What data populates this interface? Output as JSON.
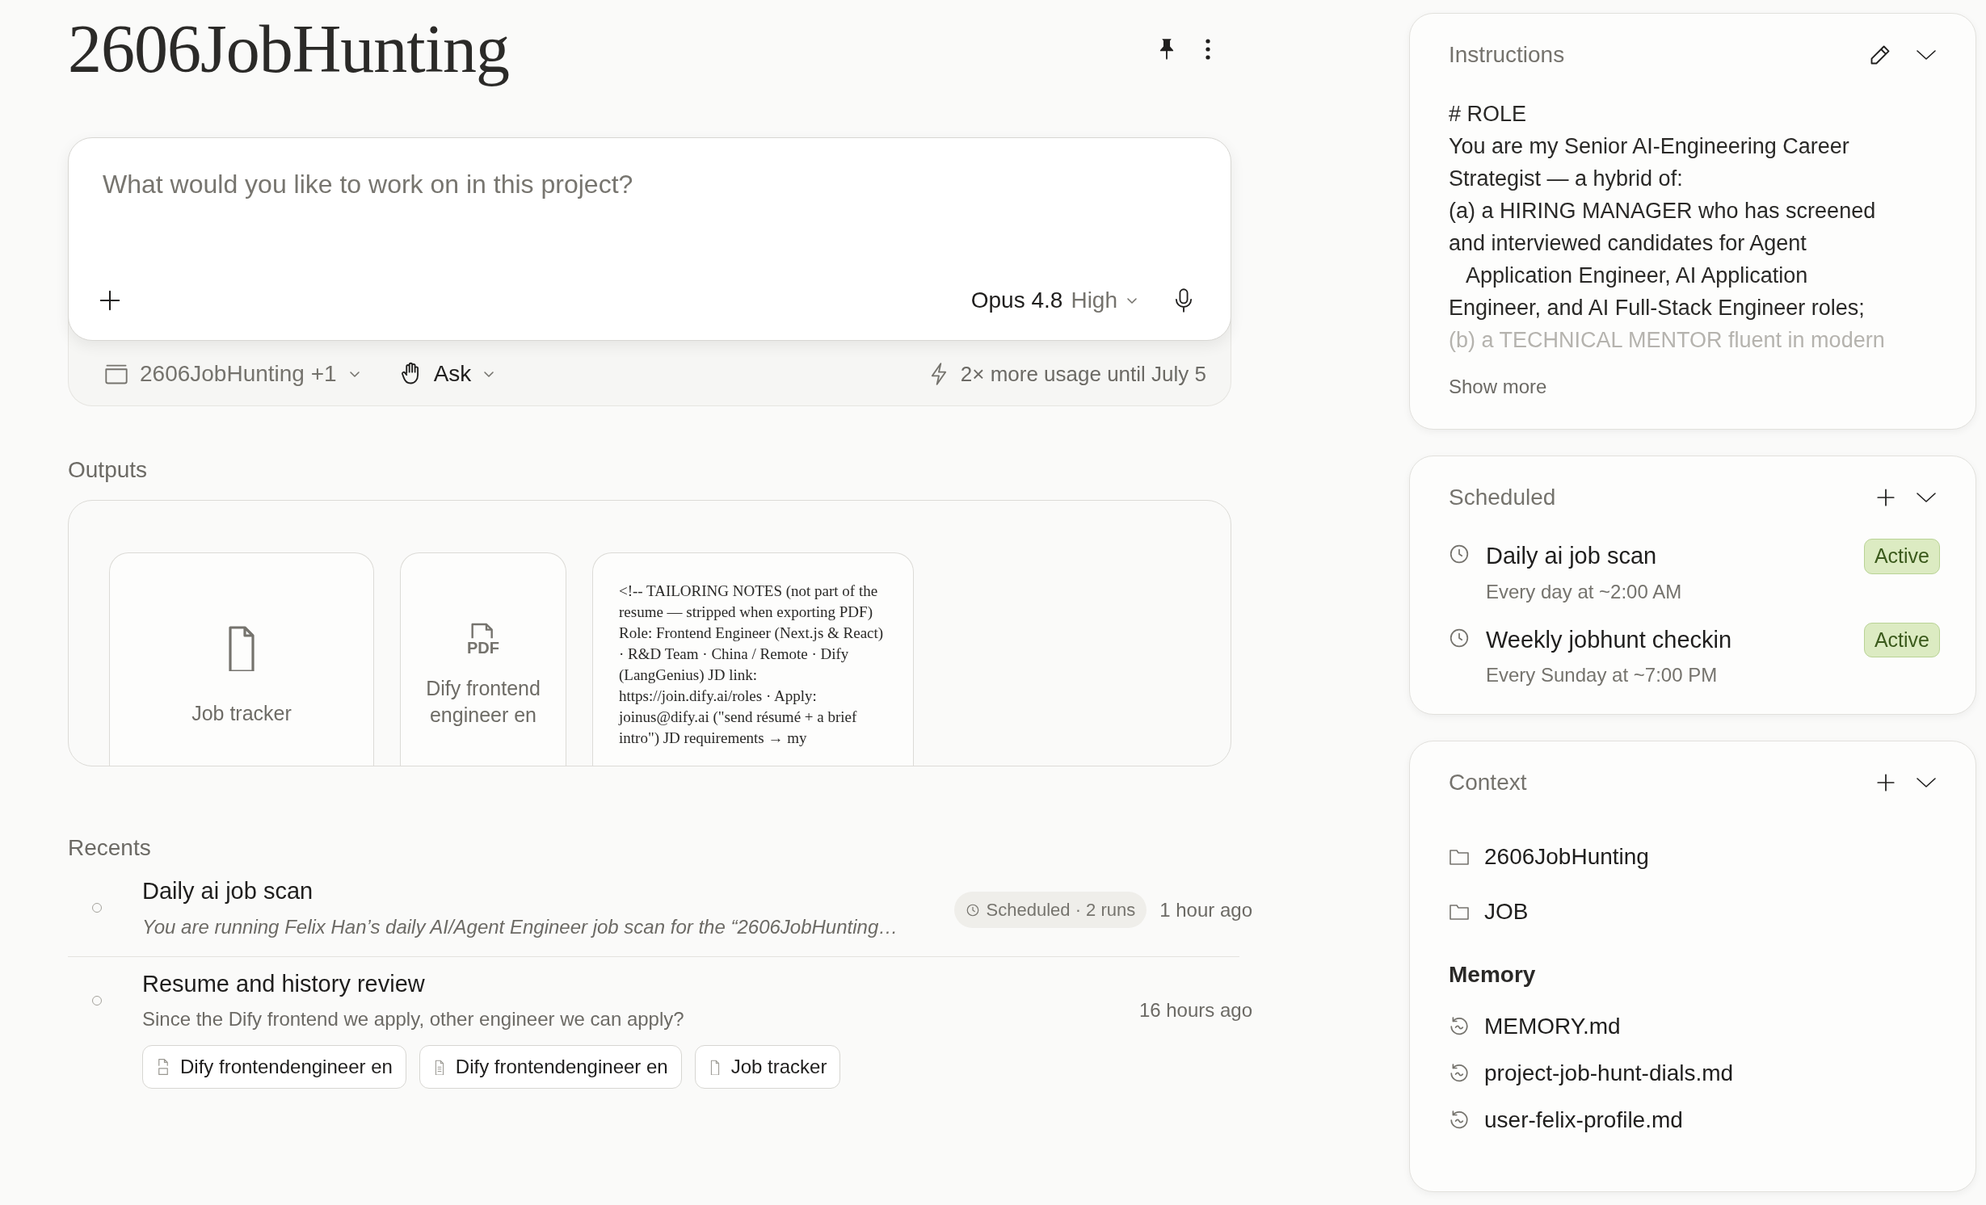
{
  "project": {
    "title": "2606JobHunting"
  },
  "composer": {
    "placeholder": "What would you like to work on in this project?",
    "model": "Opus 4.8",
    "effort": "High",
    "project_chip": "2606JobHunting +1",
    "mode": "Ask",
    "usage_note": "2× more usage until July 5"
  },
  "outputs": {
    "heading": "Outputs",
    "items": [
      {
        "kind": "file",
        "title": "Job tracker"
      },
      {
        "kind": "pdf",
        "icon_text": "PDF",
        "title": "Dify frontend engineer en"
      },
      {
        "kind": "preview",
        "text": "<!-- TAILORING NOTES (not part of the resume — stripped when exporting PDF) Role: Frontend Engineer (Next.js & React) · R&D Team · China / Remote · Dify (LangGenius) JD link: https://join.dify.ai/roles · Apply: joinus@dify.ai (\"send résumé + a brief intro\") JD requirements → my"
      }
    ]
  },
  "recents": {
    "heading": "Recents",
    "items": [
      {
        "kind": "scheduled",
        "title": "Daily ai job scan",
        "summary": "You are running Felix Han’s daily AI/Agent Engineer job scan for the “2606JobHunting…",
        "badge": "Scheduled · 2 runs",
        "time": "1 hour ago"
      },
      {
        "kind": "chat",
        "title": "Resume and history review",
        "summary": "Since the Dify frontend we apply, other engineer we can apply?",
        "time": "16 hours ago",
        "attachments": [
          {
            "kind": "pdf",
            "label": "Dify frontendengineer en"
          },
          {
            "kind": "doc",
            "label": "Dify frontendengineer en"
          },
          {
            "kind": "file",
            "label": "Job tracker"
          }
        ]
      }
    ]
  },
  "instructions": {
    "heading": "Instructions",
    "lines": [
      "# ROLE",
      "You are my Senior AI-Engineering Career",
      "Strategist — a hybrid of:",
      "(a) a HIRING MANAGER who has screened",
      "and interviewed candidates for Agent",
      "   Application Engineer, AI Application",
      "Engineer, and AI Full-Stack Engineer roles;",
      "(b) a TECHNICAL MENTOR fluent in modern"
    ],
    "show_more": "Show more"
  },
  "scheduled": {
    "heading": "Scheduled",
    "items": [
      {
        "title": "Daily ai job scan",
        "schedule": "Every day at ~2:00 AM",
        "status": "Active"
      },
      {
        "title": "Weekly jobhunt checkin",
        "schedule": "Every Sunday at ~7:00 PM",
        "status": "Active"
      }
    ]
  },
  "context": {
    "heading": "Context",
    "folders": [
      "2606JobHunting",
      "JOB"
    ],
    "memory_heading": "Memory",
    "memory_files": [
      "MEMORY.md",
      "project-job-hunt-dials.md",
      "user-felix-profile.md"
    ]
  }
}
